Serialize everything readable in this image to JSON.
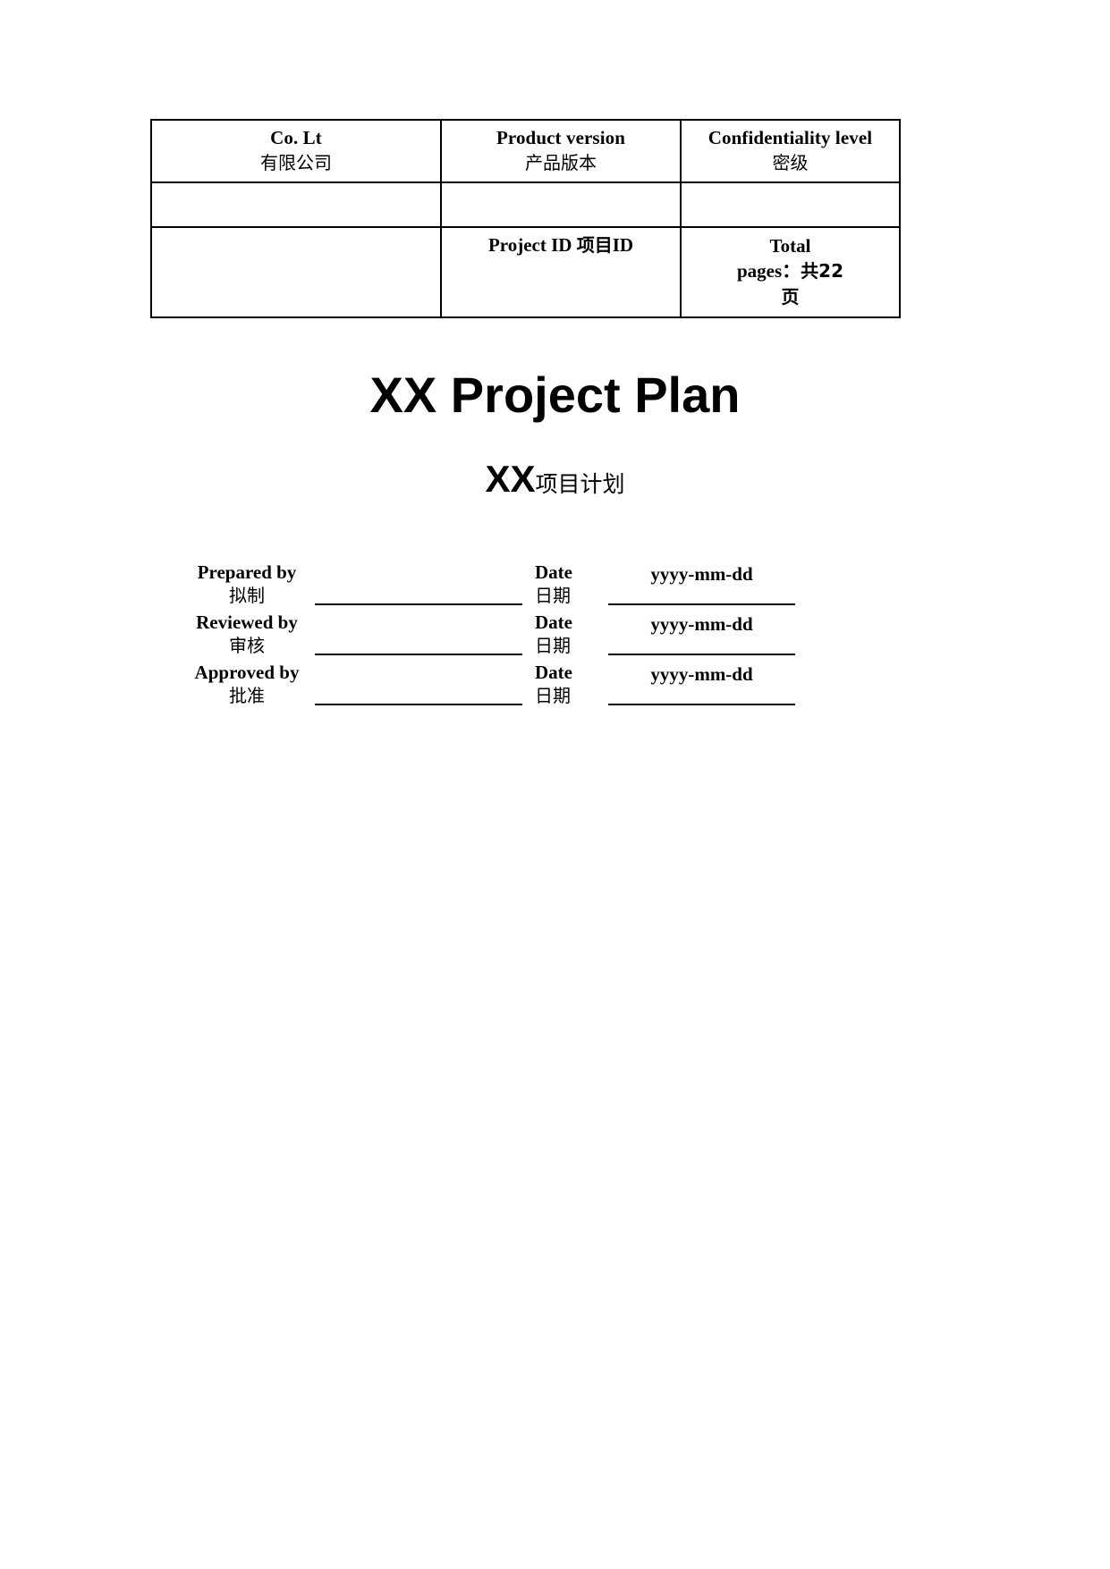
{
  "document": {
    "title_en": "XX Project Plan",
    "subtitle_prefix": "XX",
    "subtitle_cn": "项目计划"
  },
  "info_table": {
    "rows": [
      {
        "cells": [
          {
            "en": "Co. Lt",
            "cn": "有限公司"
          },
          {
            "en": "Product version",
            "cn": "产品版本"
          },
          {
            "en": "Confidentiality level",
            "cn": "密级"
          }
        ]
      },
      {
        "cells": [
          {
            "en": "",
            "cn": ""
          },
          {
            "en": "",
            "cn": ""
          },
          {
            "en": "",
            "cn": ""
          }
        ]
      },
      {
        "cells": [
          {
            "en": "",
            "cn": ""
          },
          {
            "en": "Project ID ",
            "cn": "项目ID"
          },
          {
            "en": "Total pages：",
            "cn": "共22 页"
          }
        ]
      }
    ],
    "project_id_label": "Project ID ",
    "project_id_cn": "项目",
    "project_id_suffix": "ID",
    "total_pages_line1": "Total",
    "total_pages_line2_en": "pages：",
    "total_pages_count": "共22",
    "total_pages_unit": "页"
  },
  "signatures": {
    "rows": [
      {
        "role_en": "Prepared by",
        "role_cn": "拟制",
        "signature_value": "",
        "date_en": "Date",
        "date_cn": "日期",
        "date_value": "yyyy-mm-dd"
      },
      {
        "role_en": "Reviewed by",
        "role_cn": "审核",
        "signature_value": "",
        "date_en": "Date",
        "date_cn": "日期",
        "date_value": "yyyy-mm-dd"
      },
      {
        "role_en": "Approved by",
        "role_cn": "批准",
        "signature_value": "",
        "date_en": "Date",
        "date_cn": "日期",
        "date_value": "yyyy-mm-dd"
      }
    ]
  },
  "colors": {
    "text": "#000000",
    "page_background": "#ffffff",
    "border": "#000000"
  }
}
